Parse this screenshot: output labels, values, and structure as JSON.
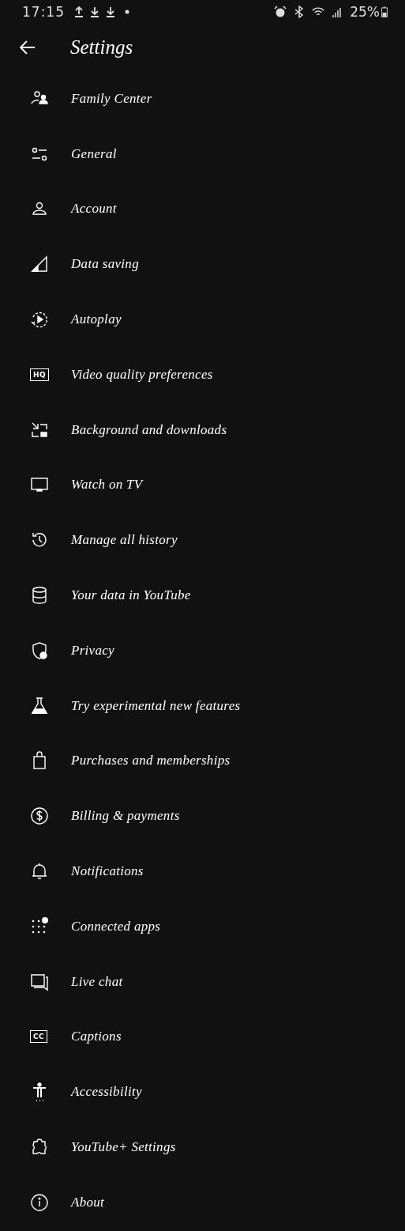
{
  "status_bar": {
    "time": "17:15",
    "battery": "25%"
  },
  "header": {
    "title": "Settings"
  },
  "items": [
    {
      "label": "Family Center"
    },
    {
      "label": "General"
    },
    {
      "label": "Account"
    },
    {
      "label": "Data saving"
    },
    {
      "label": "Autoplay"
    },
    {
      "label": "Video quality preferences",
      "icon_text": "HQ"
    },
    {
      "label": "Background and downloads"
    },
    {
      "label": "Watch on TV"
    },
    {
      "label": "Manage all history"
    },
    {
      "label": "Your data in YouTube"
    },
    {
      "label": "Privacy"
    },
    {
      "label": "Try experimental new features"
    },
    {
      "label": "Purchases and memberships"
    },
    {
      "label": "Billing & payments"
    },
    {
      "label": "Notifications"
    },
    {
      "label": "Connected apps"
    },
    {
      "label": "Live chat"
    },
    {
      "label": "Captions",
      "icon_text": "CC"
    },
    {
      "label": "Accessibility"
    },
    {
      "label": "YouTube+ Settings"
    },
    {
      "label": "About"
    }
  ]
}
